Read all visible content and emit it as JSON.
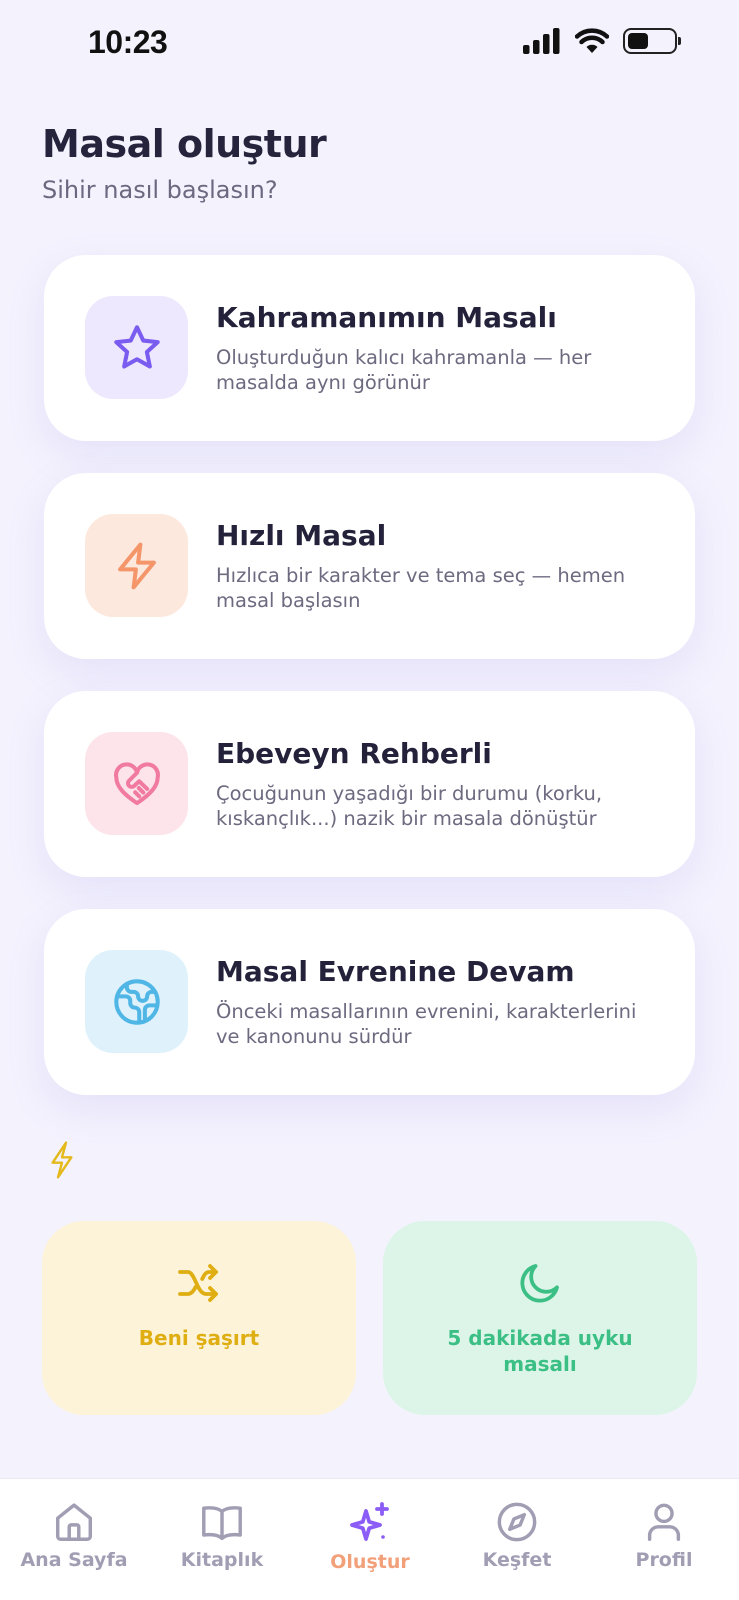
{
  "status_bar": {
    "time": "10:23",
    "battery_level": 0.45
  },
  "header": {
    "title": "Masal oluştur",
    "subtitle": "Sihir nasıl başlasın?"
  },
  "options": [
    {
      "title": "Kahramanımın Masalı",
      "description": "Oluşturduğun kalıcı kahramanla — her masalda aynı görünür",
      "icon": "star-icon",
      "icon_color": "#7b5cf0",
      "icon_bg": "#ede8fd"
    },
    {
      "title": "Hızlı Masal",
      "description": "Hızlıca bir karakter ve tema seç — hemen masal başlasın",
      "icon": "lightning-icon",
      "icon_color": "#f4956a",
      "icon_bg": "#fde8de"
    },
    {
      "title": "Ebeveyn Rehberli",
      "description": "Çocuğunun yaşadığı bir durumu (korku, kıskançlık...) nazik bir masala dönüştür",
      "icon": "heart-handshake-icon",
      "icon_color": "#f17aa0",
      "icon_bg": "#fde3ea"
    },
    {
      "title": "Masal Evrenine Devam",
      "description": "Önceki masallarının evrenini, karakterlerini ve kanonunu sürdür",
      "icon": "globe-icon",
      "icon_color": "#4fb6e6",
      "icon_bg": "#dff2fc"
    }
  ],
  "quick_actions": [
    {
      "label": "Beni şaşırt",
      "icon": "shuffle-icon",
      "color": "#dfae12",
      "bg": "#fdf3d8"
    },
    {
      "label": "5 dakikada uyku masalı",
      "icon": "moon-icon",
      "color": "#3bbf85",
      "bg": "#ddf5e8"
    }
  ],
  "bottom_nav": [
    {
      "label": "Ana Sayfa",
      "icon": "home-icon",
      "active": false
    },
    {
      "label": "Kitaplık",
      "icon": "book-icon",
      "active": false
    },
    {
      "label": "Oluştur",
      "icon": "sparkles-icon",
      "active": true
    },
    {
      "label": "Keşfet",
      "icon": "compass-icon",
      "active": false
    },
    {
      "label": "Profil",
      "icon": "user-icon",
      "active": false
    }
  ],
  "colors": {
    "background": "#f4f2fd",
    "nav_active_icon": "#8b5cf6",
    "nav_active_label": "#f1a079",
    "nav_inactive": "#a19eb4",
    "decor_bolt": "#e4b91a"
  }
}
